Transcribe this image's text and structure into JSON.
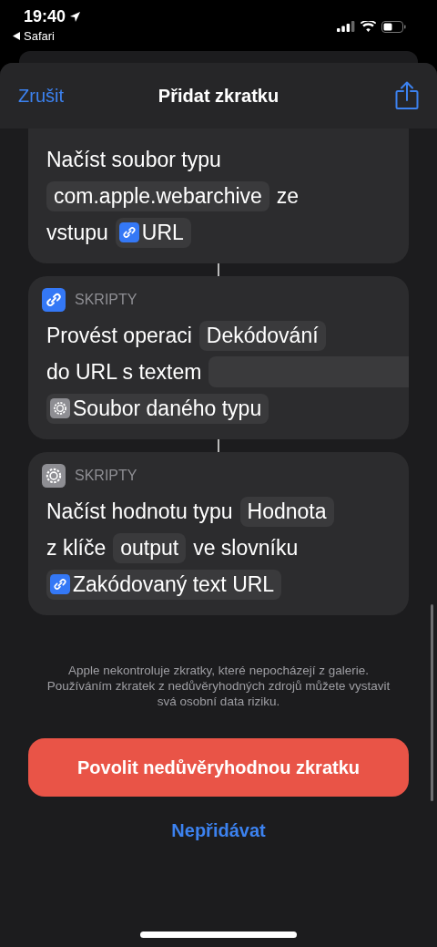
{
  "status_bar": {
    "time": "19:40",
    "back_app": "Safari"
  },
  "header": {
    "cancel": "Zrušit",
    "title": "Přidat zkratku"
  },
  "actions": [
    {
      "kind": "plain",
      "lines": [
        [
          {
            "kind": "text",
            "text": "Načíst soubor typu"
          }
        ],
        [
          {
            "kind": "token",
            "text": "com.apple.webarchive"
          },
          {
            "kind": "text",
            "text": "ze"
          }
        ],
        [
          {
            "kind": "text",
            "text": "vstupu"
          },
          {
            "kind": "link_variable",
            "text": "URL"
          }
        ]
      ]
    },
    {
      "kind": "link",
      "category": "SKRIPTY",
      "lines": [
        [
          {
            "kind": "text",
            "text": "Provést operaci"
          },
          {
            "kind": "token",
            "text": "Dekódování"
          }
        ],
        [
          {
            "kind": "text",
            "text": "do URL s textem"
          },
          {
            "kind": "empty"
          }
        ],
        [
          {
            "kind": "gear_variable",
            "text": "Soubor daného typu"
          }
        ]
      ]
    },
    {
      "kind": "gear",
      "category": "SKRIPTY",
      "lines": [
        [
          {
            "kind": "text",
            "text": "Načíst hodnotu typu"
          },
          {
            "kind": "token",
            "text": "Hodnota"
          }
        ],
        [
          {
            "kind": "text",
            "text": "z klíče"
          },
          {
            "kind": "token",
            "text": "output"
          },
          {
            "kind": "text",
            "text": "ve slovníku"
          }
        ],
        [
          {
            "kind": "link_variable",
            "text": "Zakódovaný text URL"
          }
        ]
      ]
    }
  ],
  "disclaimer": "Apple nekontroluje zkratky, které nepocházejí z galerie. Používáním zkratek z nedůvěryhodných zdrojů můžete vystavit svá osobní data riziku.",
  "primary_button": "Povolit nedůvěryhodnou zkratku",
  "secondary_button": "Nepřidávat"
}
